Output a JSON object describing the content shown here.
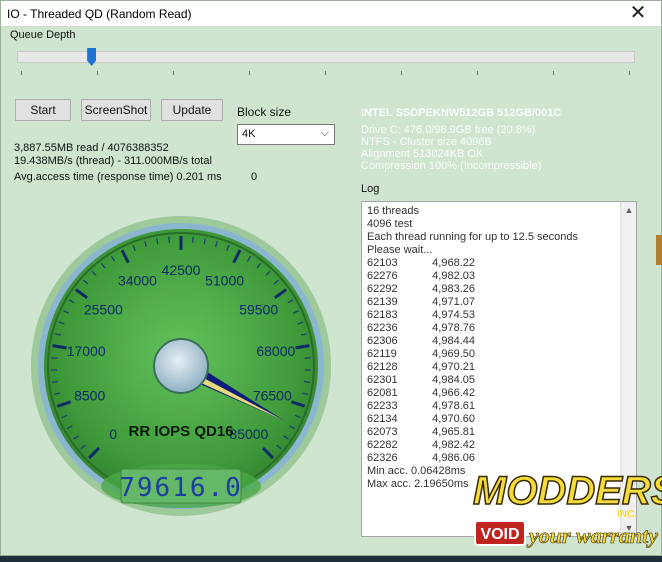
{
  "window": {
    "title": "IO - Threaded QD (Random Read)",
    "close_glyph": "✕"
  },
  "queue_depth": {
    "label": "Queue Depth",
    "fraction": 0.12
  },
  "buttons": {
    "start": "Start",
    "screenshot": "ScreenShot",
    "update": "Update"
  },
  "block_size": {
    "label": "Block size",
    "selected": "4K",
    "chevron": "⌵"
  },
  "stats": {
    "read": "3,887.55MB read / 4076388352",
    "speed": "19.438MB/s (thread) - 311.000MB/s total",
    "access": "Avg.access time (response time) 0.201 ms",
    "zero": "0"
  },
  "drive": {
    "model": "INTEL SSDPEKNW512GB 512GB/001C",
    "free": "Drive C: 476.0/98.9GB free (20.8%)",
    "ntfs": "NTFS - Cluster size 4096B",
    "alignment": "Alignment 513024KB OK",
    "compression": "Compression 100% (Incompressible)"
  },
  "log": {
    "label": "Log",
    "header": [
      "16 threads",
      "4096 test",
      "Each thread running for up to 12.5 seconds",
      "Please wait..."
    ],
    "rows": [
      [
        "62103",
        "4,968.22"
      ],
      [
        "62276",
        "4,982.03"
      ],
      [
        "62292",
        "4,983.26"
      ],
      [
        "62139",
        "4,971.07"
      ],
      [
        "62183",
        "4,974.53"
      ],
      [
        "62236",
        "4,978.76"
      ],
      [
        "62306",
        "4,984.44"
      ],
      [
        "62119",
        "4,969.50"
      ],
      [
        "62128",
        "4,970.21"
      ],
      [
        "62301",
        "4,984.05"
      ],
      [
        "62081",
        "4,966.42"
      ],
      [
        "62233",
        "4,978.61"
      ],
      [
        "62134",
        "4,970.60"
      ],
      [
        "62073",
        "4,965.81"
      ],
      [
        "62282",
        "4,982.42"
      ],
      [
        "62326",
        "4,986.06"
      ]
    ],
    "footer": [
      "Min acc. 0.06428ms",
      "Max acc. 2.19650ms"
    ]
  },
  "gauge": {
    "labels": [
      "0",
      "8500",
      "17000",
      "25500",
      "34000",
      "42500",
      "51000",
      "59500",
      "68000",
      "76500",
      "85000"
    ],
    "max": 85000,
    "value": 79616.0,
    "title": "RR IOPS QD16",
    "readout": "79616.0",
    "colors": {
      "face": "#3f9a3a",
      "rim": "#6fa0c0",
      "needle": "#0c1c7a",
      "text": "#0a2a6a"
    }
  },
  "watermark": {
    "brand": "MODDERS",
    "inc": "INC.",
    "void": "VOID",
    "tagline": "your warranty"
  }
}
